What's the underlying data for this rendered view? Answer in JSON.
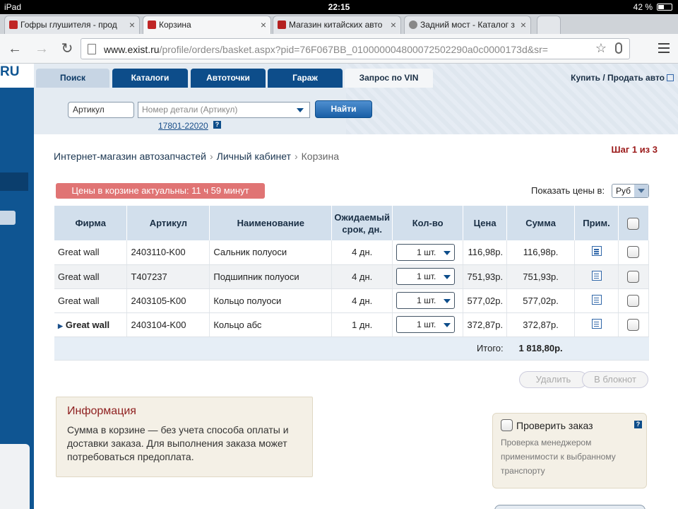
{
  "status_bar": {
    "device": "iPad",
    "time": "22:15",
    "battery": "42 %"
  },
  "browser_tabs": [
    {
      "title": "Гофры глушителя - прод",
      "favicon_color": "#c02626"
    },
    {
      "title": "Корзина",
      "favicon_color": "#c02626"
    },
    {
      "title": "Магазин китайских авто",
      "favicon_color": "#b42020"
    },
    {
      "title": "Задний мост - Каталог з",
      "favicon_color": "#888888"
    }
  ],
  "omnibox": {
    "domain": "www.exist.ru",
    "path": "/profile/orders/basket.aspx?pid=76F067BB_010000004800072502290a0c0000173d&sr="
  },
  "site": {
    "logo_text": "RU",
    "nav_tabs": [
      "Поиск",
      "Каталоги",
      "Автоточки",
      "Гараж",
      "Запрос по VIN"
    ],
    "buy_link": "Купить / Продать авто",
    "search": {
      "type_select": "Артикул",
      "placeholder": "Номер детали (Артикул)",
      "button": "Найти",
      "example": "17801-22020",
      "help": "?"
    }
  },
  "breadcrumb": [
    "Интернет-магазин автозапчастей",
    "Личный кабинет",
    "Корзина"
  ],
  "step": "Шаг 1 из 3",
  "timer_text": "Цены в корзине актуальны: 11 ч 59 минут",
  "show_prices_label": "Показать цены в:",
  "currency": "Руб",
  "table": {
    "headers": [
      "Фирма",
      "Артикул",
      "Наименование",
      "Ожидаемый срок, дн.",
      "Кол-во",
      "Цена",
      "Сумма",
      "Прим."
    ],
    "rows": [
      {
        "firm": "Great wall",
        "article": "2403110-K00",
        "name": "Сальник полуоси",
        "days": "4 дн.",
        "qty": "1",
        "unit": "шт.",
        "price": "116,98р.",
        "sum": "116,98р."
      },
      {
        "firm": "Great wall",
        "article": "T407237",
        "name": "Подшипник полуоси",
        "days": "4 дн.",
        "qty": "1",
        "unit": "шт.",
        "price": "751,93р.",
        "sum": "751,93р."
      },
      {
        "firm": "Great wall",
        "article": "2403105-K00",
        "name": "Кольцо полуоси",
        "days": "4 дн.",
        "qty": "1",
        "unit": "шт.",
        "price": "577,02р.",
        "sum": "577,02р."
      },
      {
        "firm": "Great wall",
        "article": "2403104-K00",
        "name": "Кольцо абс",
        "days": "1 дн.",
        "qty": "1",
        "unit": "шт.",
        "price": "372,87р.",
        "sum": "372,87р."
      }
    ],
    "total_label": "Итого:",
    "total_value": "1 818,80р."
  },
  "buttons": {
    "delete": "Удалить",
    "to_notepad": "В блокнот"
  },
  "info": {
    "title": "Информация",
    "text": "Сумма в корзине — без учета способа оплаты и доставки заказа. Для выполнения заказа может потребоваться предоплата."
  },
  "check_order": {
    "label": "Проверить заказ",
    "description": "Проверка менеджером применимости к выбранному транспорту",
    "help": "?"
  }
}
